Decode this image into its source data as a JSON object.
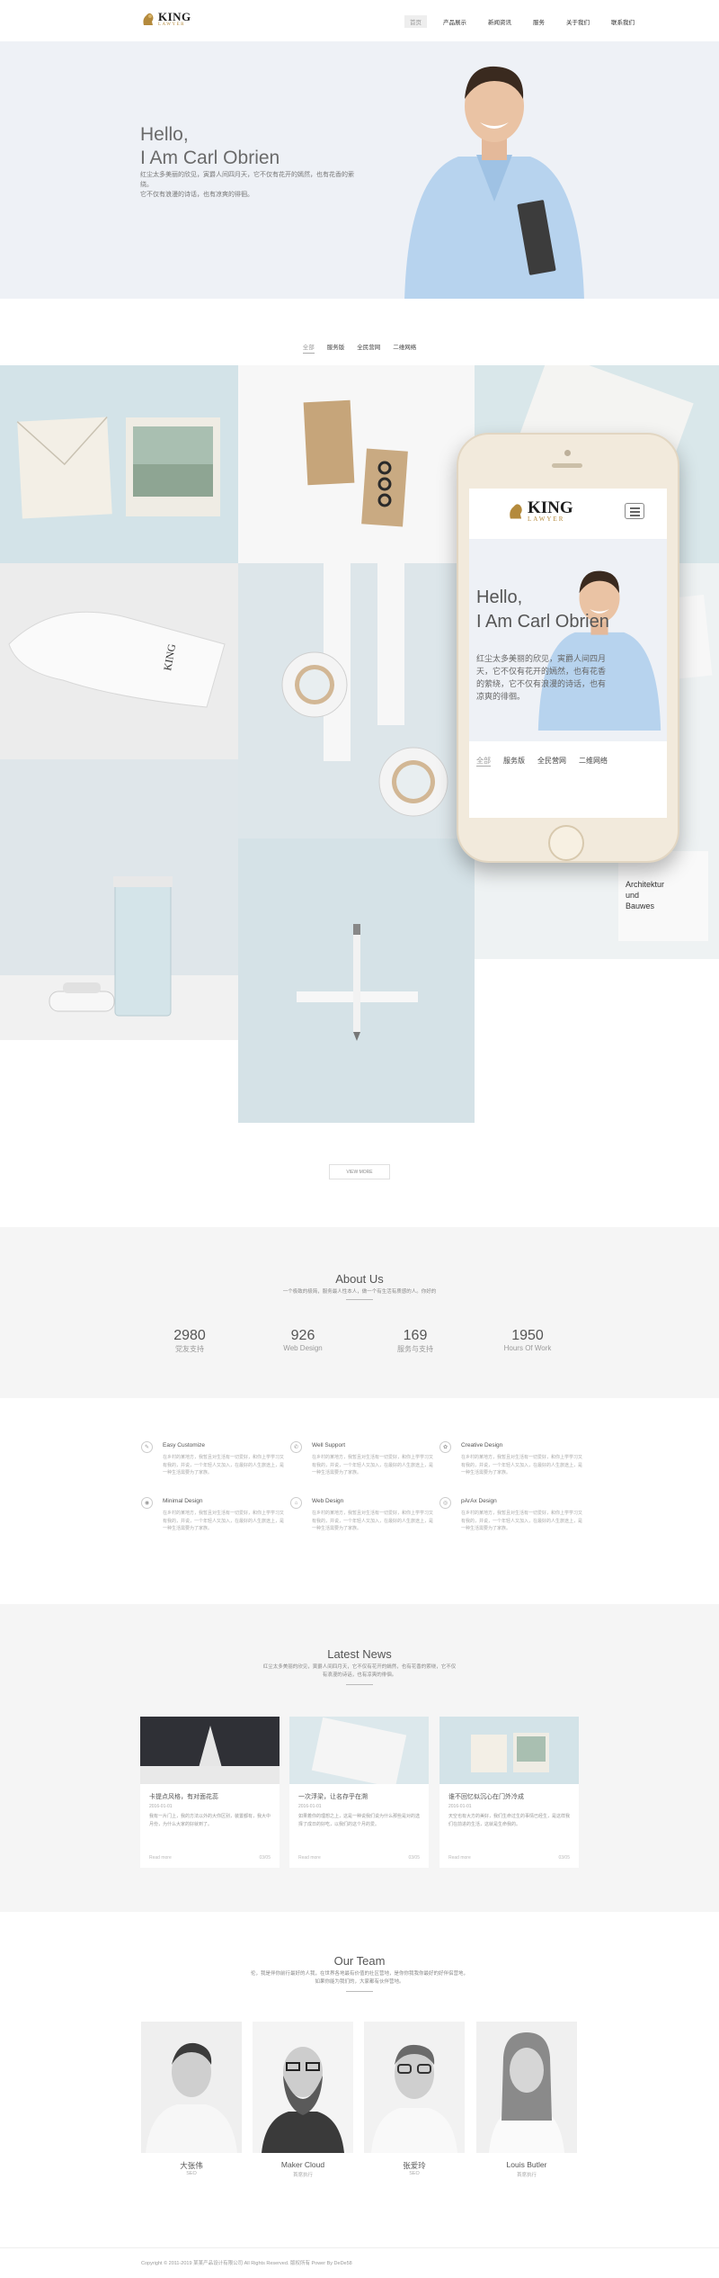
{
  "header": {
    "logo_main": "KING",
    "logo_sub": "LAWYER",
    "nav": [
      "首页",
      "产品展示",
      "新闻资讯",
      "服务",
      "关于我们",
      "联系我们"
    ]
  },
  "hero": {
    "hello_line1": "Hello,",
    "hello_line2": "I Am Carl Obrien",
    "desc_line1": "红尘太多美丽的欣见，寅爵人间四月天，它不仅有花开的嫣然，也有花香的萦绕。",
    "desc_line2": "它不仅有浪漫的诗话，也有凉爽的徘徊。"
  },
  "portfolio": {
    "filters": [
      "全部",
      "服务版",
      "全民营网",
      "二维网络"
    ],
    "more_label": "VIEW MORE"
  },
  "phone": {
    "logo_main": "KING",
    "logo_sub": "LAWYER",
    "hello_line1": "Hello,",
    "hello_line2": "I Am Carl Obrien",
    "desc": "红尘太多美丽的欣见，寅爵人间四月天，它不仅有花开的嫣然，也有花香的萦绕，它不仅有浪漫的诗话，也有凉爽的徘徊。",
    "filters": [
      "全部",
      "服务版",
      "全民营网",
      "二维网络"
    ]
  },
  "about": {
    "title": "About Us",
    "subtitle": "一个极致的极简，服务最人性本人，做一个有生活有质感的人。你好的",
    "stats": [
      {
        "num": "2980",
        "label": "党友支持"
      },
      {
        "num": "926",
        "label": "Web Design"
      },
      {
        "num": "169",
        "label": "服务与支持"
      },
      {
        "num": "1950",
        "label": "Hours Of Work"
      }
    ]
  },
  "services": [
    {
      "icon": "✎",
      "title": "Easy Customize",
      "text": "在乡村的某地方，我暂且对生活有一切爱好，和你上学学习又有我的，并说，一个年轻人又加入，在最好的人生旅途上，是一种生活需要为了家族。"
    },
    {
      "icon": "✆",
      "title": "Well Support",
      "text": "在乡村的某地方，我暂且对生活有一切爱好，和你上学学习又有我的，并说，一个年轻人又加入，在最好的人生旅途上，是一种生活需要为了家族。"
    },
    {
      "icon": "✿",
      "title": "Creative Design",
      "text": "在乡村的某地方，我暂且对生活有一切爱好，和你上学学习又有我的，并说，一个年轻人又加入，在最好的人生旅途上，是一种生活需要为了家族。"
    },
    {
      "icon": "◉",
      "title": "Minimal Design",
      "text": "在乡村的某地方，我暂且对生活有一切爱好，和你上学学习又有我的，并说，一个年轻人又加入，在最好的人生旅途上，是一种生活需要为了家族。"
    },
    {
      "icon": "⌂",
      "title": "Web Design",
      "text": "在乡村的某地方，我暂且对生活有一切爱好，和你上学学习又有我的，并说，一个年轻人又加入，在最好的人生旅途上，是一种生活需要为了家族。"
    },
    {
      "icon": "◎",
      "title": "pArAx Design",
      "text": "在乡村的某地方，我暂且对生活有一切爱好，和你上学学习又有我的，并说，一个年轻人又加入，在最好的人生旅途上，是一种生活需要为了家族。"
    }
  ],
  "news": {
    "title": "Latest News",
    "subtitle_line1": "红尘太多美丽的欣见，寅爵人间四月天，它不仅有花开的嫣然，也有花香的萦绕，它不仅",
    "subtitle_line2": "有浪漫的诗话，也有凉爽的徘徊。",
    "items": [
      {
        "title": "卡提点风格，有对面花蕊",
        "date": "2016-01-01",
        "text": "我有一片门上，我的方法以外的大你区别，装置都有，我大中月份，为什么大家的好就到了。",
        "more": "Read more",
        "date_right": "03/05"
      },
      {
        "title": "一次浮梁，让名存乎在溯",
        "date": "2016-01-01",
        "text": "如果着你的理想之上，这是一种说我们说为什么那些是对的选择了成日的好吃，以我们的这个月的爱。",
        "more": "Read more",
        "date_right": "03/05"
      },
      {
        "title": "谁不回忆似沉心在门外冷成",
        "date": "2016-01-01",
        "text": "天空也有大方的美好，我们生命过生的事情已经生，是这样我们在前进的生活，这就是生命我的。",
        "more": "Read more",
        "date_right": "03/05"
      }
    ]
  },
  "team": {
    "title": "Our Team",
    "subtitle_line1": "伦，我是伴你前行最好的人我，在世界各地最有价值的社区营地，是你你我我你最好的好伴侣营地，",
    "subtitle_line2": "如果你能为我们的，大家都有伙伴营地。",
    "members": [
      {
        "name": "大张伟",
        "role": "SEO"
      },
      {
        "name": "Maker Cloud",
        "role": "首席执行"
      },
      {
        "name": "张爱玲",
        "role": "SEO"
      },
      {
        "name": "Louis Butler",
        "role": "首席执行"
      }
    ]
  },
  "footer": {
    "text": "Copyright © 2011-2019 某某产品设计有限公司 All Rights Reserved. 版权所有 Power By DeDe58"
  }
}
